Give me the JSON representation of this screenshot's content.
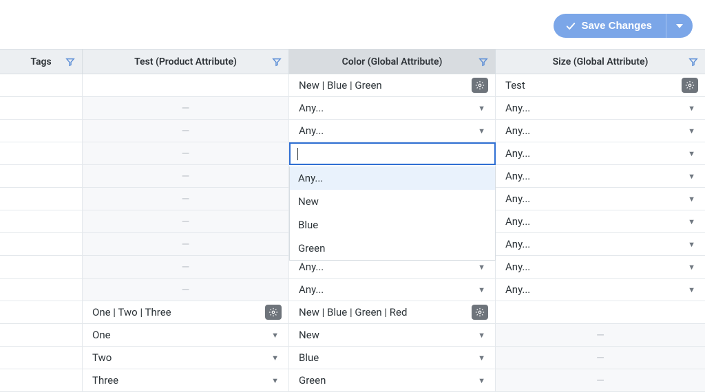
{
  "toolbar": {
    "save_label": "Save Changes"
  },
  "columns": {
    "tags": "Tags",
    "test": "Test (Product Attribute)",
    "color": "Color (Global Attribute)",
    "size": "Size (Global Attribute)"
  },
  "headers": {
    "color_values": "New | Blue | Green",
    "size_value": "Test",
    "test_values": "One | Two | Three",
    "color_values2": "New | Blue | Green | Red"
  },
  "any": "Any...",
  "dash": "—",
  "dropdown": {
    "any": "Any...",
    "opt1": "New",
    "opt2": "Blue",
    "opt3": "Green"
  },
  "vals": {
    "one": "One",
    "two": "Two",
    "three": "Three",
    "new": "New",
    "blue": "Blue",
    "green": "Green"
  }
}
